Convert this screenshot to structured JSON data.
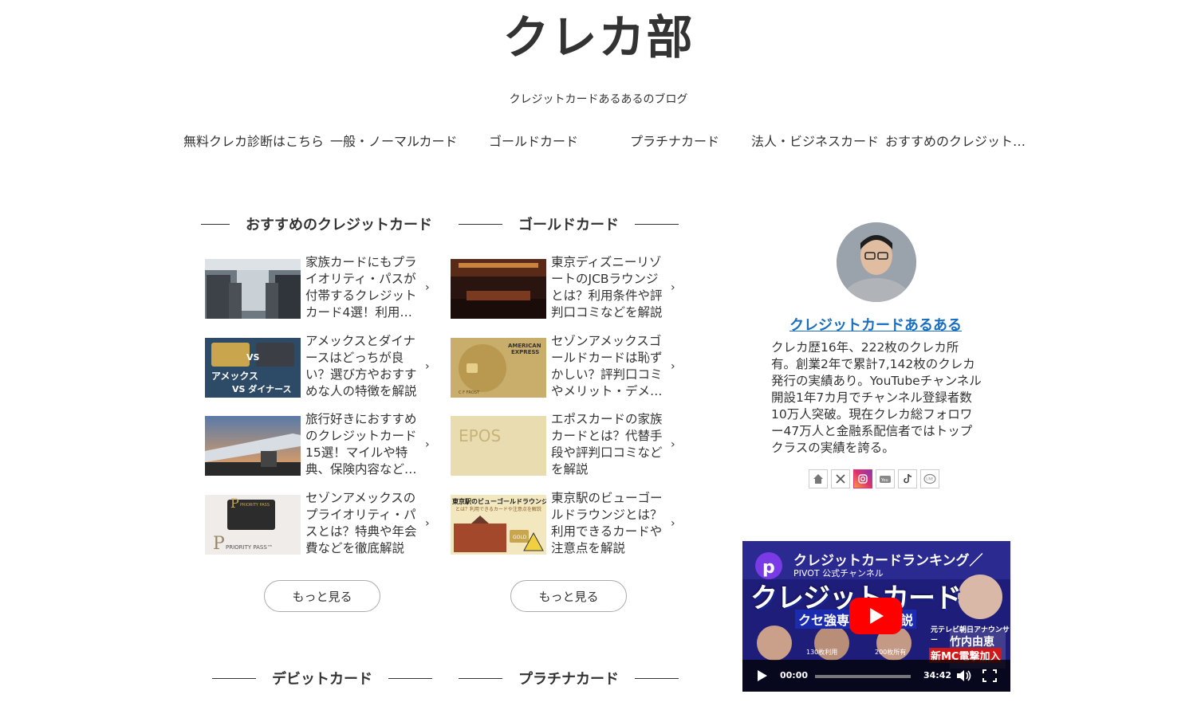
{
  "site": {
    "title": "クレカ部",
    "tagline": "クレジットカードあるあるのブログ"
  },
  "nav": [
    "無料クレカ診断はこちら",
    "一般・ノーマルカード",
    "ゴールドカード",
    "プラチナカード",
    "法人・ビジネスカード",
    "おすすめのクレジット…"
  ],
  "sections": {
    "recommended": {
      "title": "おすすめのクレジットカード",
      "items": [
        "家族カードにもプライオリティ・パスが付帯するクレジットカード4選！利用…",
        "アメックスとダイナースはどっちが良い？選び方やおすすめな人の特徴を解説",
        "旅行好きにおすすめのクレジットカード15選！マイルや特典、保険内容など…",
        "セゾンアメックスのプライオリティ・パスとは？特典や年会費などを徹底解説"
      ],
      "more": "もっと見る"
    },
    "gold": {
      "title": "ゴールドカード",
      "items": [
        "東京ディズニーリゾートのJCBラウンジとは？利用条件や評判口コミなどを解説",
        "セゾンアメックスゴールドカードは恥ずかしい？評判口コミやメリット・デメ…",
        "エポスカードの家族カードとは？代替手段や評判口コミなどを解説",
        "東京駅のビューゴールドラウンジとは？利用できるカードや注意点を解説"
      ],
      "more": "もっと見る"
    },
    "debit": {
      "title": "デビットカード"
    },
    "platinum": {
      "title": "プラチナカード"
    }
  },
  "thumbs": {
    "amex_vs": [
      "VS",
      "アメックス",
      "VS ダイナース"
    ],
    "amex_card": [
      "AMERICAN",
      "EXPRESS",
      "C F FROST"
    ],
    "epos": "EPOS",
    "priority": [
      "PRIORITY PASS",
      "PRIORITY PASS™"
    ],
    "tokyo": [
      "東京駅のビューゴールドラウンジ",
      "とは？利用できるカードや注意点を解説",
      "GOLD"
    ]
  },
  "profile": {
    "name": "クレジットカードあるある",
    "bio": "クレカ歴16年、222枚のクレカ所有。創業2年で累計7,142枚のクレカ発行の実績あり。YouTubeチャンネル開設1年7カ月でチャンネル登録者数10万人突破。現在クレカ総フォロワー47万人と金融系配信者ではトップクラスの実績を誇る。",
    "social": [
      "home-icon",
      "x-icon",
      "instagram-icon",
      "youtube-icon",
      "tiktok-icon",
      "line-icon"
    ],
    "social_labels": {
      "line": "LINE",
      "youtube": "You"
    }
  },
  "video": {
    "title": "クレジットカードランキング／",
    "channel": "PIVOT 公式チャンネル",
    "headline": "クレジットカード",
    "subhead": "クセ強専門家が解説",
    "announcer_role": "元テレビ朝日アナウンサー",
    "announcer": "竹内由恵",
    "badge": "新MC電撃加入",
    "caption_left": "130枚利用",
    "caption_right": "200枚所有",
    "current_time": "00:00",
    "duration": "34:42",
    "progress": 0
  },
  "colors": {
    "link": "#1a6ec2",
    "text": "#333333",
    "video_bg": "#1a1a6a",
    "youtube_red": "#ff0000"
  }
}
